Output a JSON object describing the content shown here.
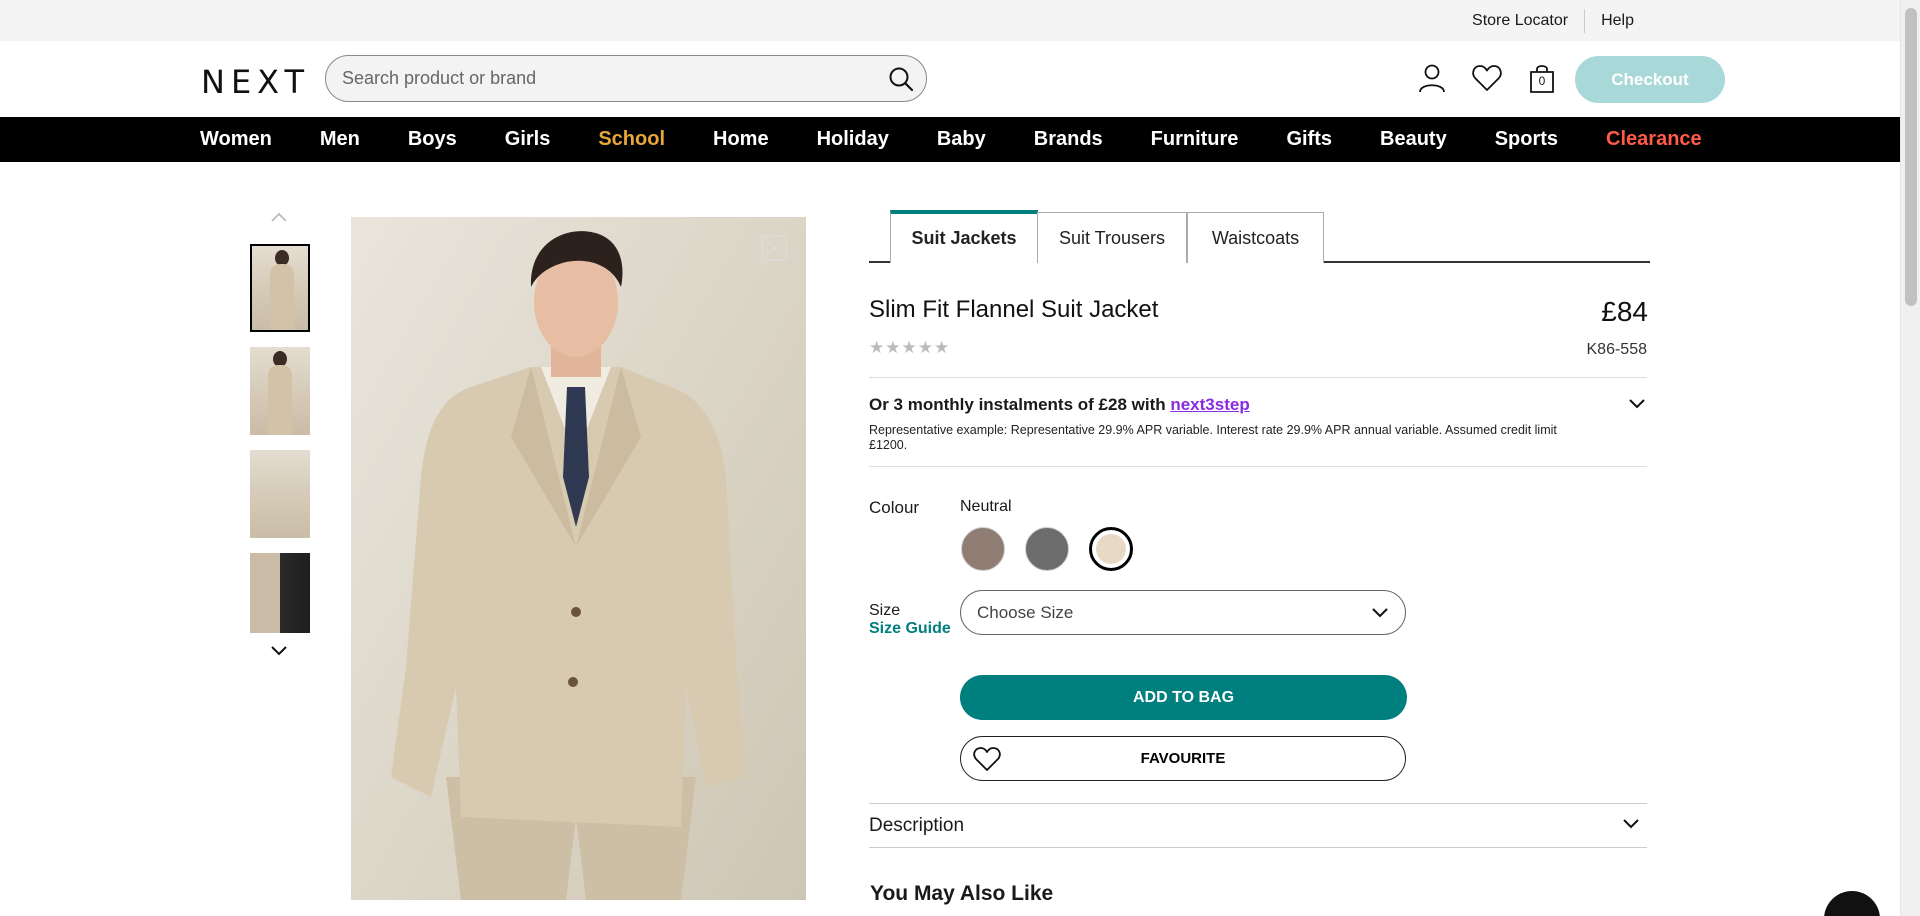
{
  "utility": {
    "store_locator": "Store Locator",
    "help": "Help"
  },
  "header": {
    "logo": "NEXT",
    "search_placeholder": "Search product or brand",
    "bag_count": "0",
    "checkout": "Checkout"
  },
  "nav": [
    "Women",
    "Men",
    "Boys",
    "Girls",
    "School",
    "Home",
    "Holiday",
    "Baby",
    "Brands",
    "Furniture",
    "Gifts",
    "Beauty",
    "Sports",
    "Clearance"
  ],
  "tabs": [
    "Suit Jackets",
    "Suit Trousers",
    "Waistcoats"
  ],
  "product": {
    "title": "Slim Fit Flannel Suit Jacket",
    "price": "£84",
    "code": "K86-558",
    "instalment_text": "Or 3 monthly instalments of £28 with ",
    "instalment_link": "next3step",
    "representative": "Representative example: Representative 29.9% APR variable. Interest rate 29.9% APR annual variable. Assumed credit limit £1200.",
    "colour_label": "Colour",
    "colour_value": "Neutral",
    "swatches": [
      "#8f7d74",
      "#6c6c6c",
      "#e8d8c6"
    ],
    "size_label": "Size",
    "size_guide": "Size Guide",
    "size_placeholder": "Choose Size",
    "add_to_bag": "ADD TO BAG",
    "favourite": "FAVOURITE",
    "description": "Description",
    "you_may_also_like": "You May Also Like"
  },
  "accent": "#007f7f"
}
